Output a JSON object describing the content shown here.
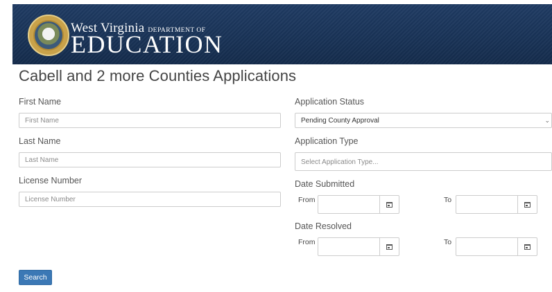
{
  "header": {
    "logo_line1": "West Virginia",
    "logo_dept": "DEPARTMENT OF",
    "logo_line2": "EDUCATION",
    "seal_text": "STATE OF WEST VIRGINIA"
  },
  "page": {
    "title": "Cabell and 2 more Counties Applications"
  },
  "form": {
    "first_name": {
      "label": "First Name",
      "placeholder": "First Name",
      "value": ""
    },
    "last_name": {
      "label": "Last Name",
      "placeholder": "Last Name",
      "value": ""
    },
    "license_number": {
      "label": "License Number",
      "placeholder": "License Number",
      "value": ""
    },
    "application_status": {
      "label": "Application Status",
      "selected": "Pending County Approval"
    },
    "application_type": {
      "label": "Application Type",
      "placeholder": "Select Application Type..."
    },
    "date_submitted": {
      "label": "Date Submitted",
      "from_label": "From",
      "to_label": "To",
      "from_value": "",
      "to_value": ""
    },
    "date_resolved": {
      "label": "Date Resolved",
      "from_label": "From",
      "to_label": "To",
      "from_value": "",
      "to_value": ""
    }
  },
  "actions": {
    "search_label": "Search"
  },
  "colors": {
    "banner": "#1f3b63",
    "primary_button": "#3b78b5",
    "seal_gold": "#c9a24a"
  },
  "icons": {
    "calendar": "calendar-icon",
    "dropdown": "chevron-down-icon",
    "seal": "state-seal-icon"
  }
}
